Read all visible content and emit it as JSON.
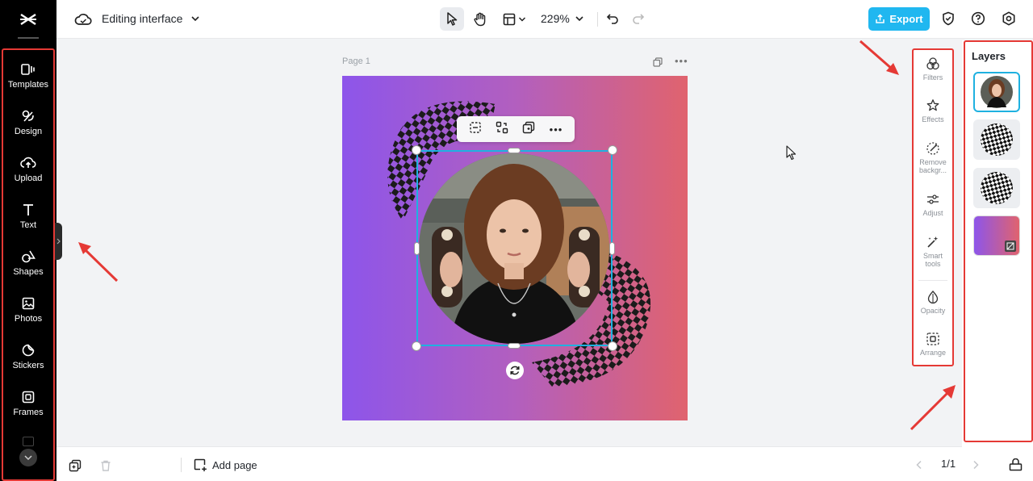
{
  "header": {
    "title": "Editing interface",
    "zoom": "229%",
    "export_label": "Export"
  },
  "rail": {
    "items": [
      {
        "label": "Templates"
      },
      {
        "label": "Design"
      },
      {
        "label": "Upload"
      },
      {
        "label": "Text"
      },
      {
        "label": "Shapes"
      },
      {
        "label": "Photos"
      },
      {
        "label": "Stickers"
      },
      {
        "label": "Frames"
      }
    ]
  },
  "canvas": {
    "page_label": "Page 1"
  },
  "tools": {
    "items": [
      {
        "label": "Filters"
      },
      {
        "label": "Effects"
      },
      {
        "label": "Remove backgr..."
      },
      {
        "label": "Adjust"
      },
      {
        "label": "Smart tools"
      },
      {
        "label": "Opacity"
      },
      {
        "label": "Arrange"
      }
    ]
  },
  "layers": {
    "title": "Layers",
    "count": 4
  },
  "footer": {
    "add_page_label": "Add page",
    "page_info": "1/1"
  },
  "colors": {
    "accent": "#20b7f0",
    "annotation": "#e53935",
    "selection": "#1fb1e0",
    "gradient_left": "#8d55ea",
    "gradient_right": "#e0636e"
  }
}
